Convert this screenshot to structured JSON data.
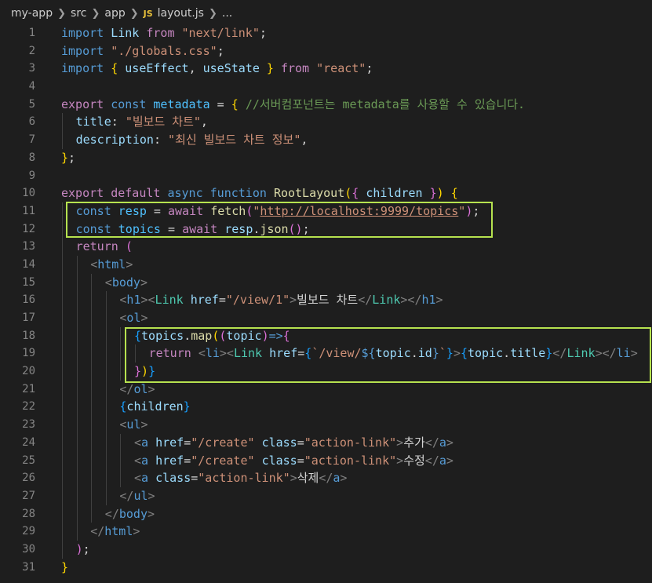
{
  "breadcrumb": {
    "items": [
      "my-app",
      "src",
      "app"
    ],
    "file_icon": "JS",
    "file_name": "layout.js",
    "ellipsis": "..."
  },
  "colors": {
    "background": "#1e1e1e",
    "highlight_box": "#b6e24f"
  },
  "icons": {
    "separator": "chevron-right-icon",
    "file": "javascript-file-icon"
  },
  "lines": [
    {
      "n": "1",
      "indent": 0,
      "tokens": [
        [
          "kw",
          "import"
        ],
        [
          "p",
          " "
        ],
        [
          "var",
          "Link"
        ],
        [
          "p",
          " "
        ],
        [
          "ctrl",
          "from"
        ],
        [
          "p",
          " "
        ],
        [
          "str",
          "\"next/link\""
        ],
        [
          "p",
          ";"
        ]
      ]
    },
    {
      "n": "2",
      "indent": 0,
      "tokens": [
        [
          "kw",
          "import"
        ],
        [
          "p",
          " "
        ],
        [
          "str",
          "\"./globals.css\""
        ],
        [
          "p",
          ";"
        ]
      ]
    },
    {
      "n": "3",
      "indent": 0,
      "tokens": [
        [
          "kw",
          "import"
        ],
        [
          "p",
          " "
        ],
        [
          "b1",
          "{"
        ],
        [
          "p",
          " "
        ],
        [
          "var",
          "useEffect"
        ],
        [
          "p",
          ", "
        ],
        [
          "var",
          "useState"
        ],
        [
          "p",
          " "
        ],
        [
          "b1",
          "}"
        ],
        [
          "p",
          " "
        ],
        [
          "ctrl",
          "from"
        ],
        [
          "p",
          " "
        ],
        [
          "str",
          "\"react\""
        ],
        [
          "p",
          ";"
        ]
      ]
    },
    {
      "n": "4",
      "indent": 0,
      "tokens": []
    },
    {
      "n": "5",
      "indent": 0,
      "tokens": [
        [
          "ctrl",
          "export"
        ],
        [
          "p",
          " "
        ],
        [
          "kw",
          "const"
        ],
        [
          "p",
          " "
        ],
        [
          "const",
          "metadata"
        ],
        [
          "p",
          " = "
        ],
        [
          "b1",
          "{"
        ],
        [
          "p",
          " "
        ],
        [
          "cmt",
          "//서버컴포넌트는 metadata를 사용할 수 있습니다."
        ]
      ]
    },
    {
      "n": "6",
      "indent": 1,
      "tokens": [
        [
          "var",
          "title"
        ],
        [
          "p",
          ": "
        ],
        [
          "str",
          "\"빌보드 차트\""
        ],
        [
          "p",
          ","
        ]
      ]
    },
    {
      "n": "7",
      "indent": 1,
      "tokens": [
        [
          "var",
          "description"
        ],
        [
          "p",
          ": "
        ],
        [
          "str",
          "\"최신 빌보드 차트 정보\""
        ],
        [
          "p",
          ","
        ]
      ]
    },
    {
      "n": "8",
      "indent": 0,
      "tokens": [
        [
          "b1",
          "}"
        ],
        [
          "p",
          ";"
        ]
      ]
    },
    {
      "n": "9",
      "indent": 0,
      "tokens": []
    },
    {
      "n": "10",
      "indent": 0,
      "tokens": [
        [
          "ctrl",
          "export"
        ],
        [
          "p",
          " "
        ],
        [
          "ctrl",
          "default"
        ],
        [
          "p",
          " "
        ],
        [
          "kw",
          "async"
        ],
        [
          "p",
          " "
        ],
        [
          "kw",
          "function"
        ],
        [
          "p",
          " "
        ],
        [
          "fn",
          "RootLayout"
        ],
        [
          "b1",
          "("
        ],
        [
          "b2",
          "{"
        ],
        [
          "p",
          " "
        ],
        [
          "var",
          "children"
        ],
        [
          "p",
          " "
        ],
        [
          "b2",
          "}"
        ],
        [
          "b1",
          ")"
        ],
        [
          "p",
          " "
        ],
        [
          "b1",
          "{"
        ]
      ]
    },
    {
      "n": "11",
      "indent": 1,
      "tokens": [
        [
          "kw",
          "const"
        ],
        [
          "p",
          " "
        ],
        [
          "const",
          "resp"
        ],
        [
          "p",
          " = "
        ],
        [
          "ctrl",
          "await"
        ],
        [
          "p",
          " "
        ],
        [
          "fn",
          "fetch"
        ],
        [
          "b2",
          "("
        ],
        [
          "str",
          "\""
        ],
        [
          "url",
          "http://localhost:9999/topics"
        ],
        [
          "str",
          "\""
        ],
        [
          "b2",
          ")"
        ],
        [
          "p",
          ";"
        ]
      ]
    },
    {
      "n": "12",
      "indent": 1,
      "tokens": [
        [
          "kw",
          "const"
        ],
        [
          "p",
          " "
        ],
        [
          "const",
          "topics"
        ],
        [
          "p",
          " = "
        ],
        [
          "ctrl",
          "await"
        ],
        [
          "p",
          " "
        ],
        [
          "var",
          "resp"
        ],
        [
          "p",
          "."
        ],
        [
          "fn",
          "json"
        ],
        [
          "b2",
          "()"
        ],
        [
          "p",
          ";"
        ]
      ]
    },
    {
      "n": "13",
      "indent": 1,
      "tokens": [
        [
          "ctrl",
          "return"
        ],
        [
          "p",
          " "
        ],
        [
          "b2",
          "("
        ]
      ]
    },
    {
      "n": "14",
      "indent": 2,
      "tokens": [
        [
          "ang",
          "<"
        ],
        [
          "tag",
          "html"
        ],
        [
          "ang",
          ">"
        ]
      ]
    },
    {
      "n": "15",
      "indent": 3,
      "tokens": [
        [
          "ang",
          "<"
        ],
        [
          "tag",
          "body"
        ],
        [
          "ang",
          ">"
        ]
      ]
    },
    {
      "n": "16",
      "indent": 4,
      "tokens": [
        [
          "ang",
          "<"
        ],
        [
          "tag",
          "h1"
        ],
        [
          "ang",
          "><"
        ],
        [
          "comp",
          "Link"
        ],
        [
          "p",
          " "
        ],
        [
          "attr",
          "href"
        ],
        [
          "p",
          "="
        ],
        [
          "str",
          "\"/view/1\""
        ],
        [
          "ang",
          ">"
        ],
        [
          "p",
          "빌보드 차트"
        ],
        [
          "ang",
          "</"
        ],
        [
          "comp",
          "Link"
        ],
        [
          "ang",
          "></"
        ],
        [
          "tag",
          "h1"
        ],
        [
          "ang",
          ">"
        ]
      ]
    },
    {
      "n": "17",
      "indent": 4,
      "tokens": [
        [
          "ang",
          "<"
        ],
        [
          "tag",
          "ol"
        ],
        [
          "ang",
          ">"
        ]
      ]
    },
    {
      "n": "18",
      "indent": 5,
      "tokens": [
        [
          "b3",
          "{"
        ],
        [
          "var",
          "topics"
        ],
        [
          "p",
          "."
        ],
        [
          "fn",
          "map"
        ],
        [
          "b1",
          "("
        ],
        [
          "b2",
          "("
        ],
        [
          "var",
          "topic"
        ],
        [
          "b2",
          ")"
        ],
        [
          "kw",
          "=>"
        ],
        [
          "b2",
          "{"
        ]
      ]
    },
    {
      "n": "19",
      "indent": 6,
      "tokens": [
        [
          "ctrl",
          "return"
        ],
        [
          "p",
          " "
        ],
        [
          "ang",
          "<"
        ],
        [
          "tag",
          "li"
        ],
        [
          "ang",
          "><"
        ],
        [
          "comp",
          "Link"
        ],
        [
          "p",
          " "
        ],
        [
          "attr",
          "href"
        ],
        [
          "p",
          "="
        ],
        [
          "b3",
          "{"
        ],
        [
          "str",
          "`/view/"
        ],
        [
          "kw",
          "${"
        ],
        [
          "var",
          "topic"
        ],
        [
          "p",
          "."
        ],
        [
          "var",
          "id"
        ],
        [
          "kw",
          "}"
        ],
        [
          "str",
          "`"
        ],
        [
          "b3",
          "}"
        ],
        [
          "ang",
          ">"
        ],
        [
          "b3",
          "{"
        ],
        [
          "var",
          "topic"
        ],
        [
          "p",
          "."
        ],
        [
          "var",
          "title"
        ],
        [
          "b3",
          "}"
        ],
        [
          "ang",
          "</"
        ],
        [
          "comp",
          "Link"
        ],
        [
          "ang",
          "></"
        ],
        [
          "tag",
          "li"
        ],
        [
          "ang",
          ">"
        ]
      ]
    },
    {
      "n": "20",
      "indent": 5,
      "tokens": [
        [
          "b2",
          "}"
        ],
        [
          "b1",
          ")"
        ],
        [
          "b3",
          "}"
        ]
      ]
    },
    {
      "n": "21",
      "indent": 4,
      "tokens": [
        [
          "ang",
          "</"
        ],
        [
          "tag",
          "ol"
        ],
        [
          "ang",
          ">"
        ]
      ]
    },
    {
      "n": "22",
      "indent": 4,
      "tokens": [
        [
          "b3",
          "{"
        ],
        [
          "var",
          "children"
        ],
        [
          "b3",
          "}"
        ]
      ]
    },
    {
      "n": "23",
      "indent": 4,
      "tokens": [
        [
          "ang",
          "<"
        ],
        [
          "tag",
          "ul"
        ],
        [
          "ang",
          ">"
        ]
      ]
    },
    {
      "n": "24",
      "indent": 5,
      "tokens": [
        [
          "ang",
          "<"
        ],
        [
          "tag",
          "a"
        ],
        [
          "p",
          " "
        ],
        [
          "attr",
          "href"
        ],
        [
          "p",
          "="
        ],
        [
          "str",
          "\"/create\""
        ],
        [
          "p",
          " "
        ],
        [
          "attr",
          "class"
        ],
        [
          "p",
          "="
        ],
        [
          "str",
          "\"action-link\""
        ],
        [
          "ang",
          ">"
        ],
        [
          "p",
          "추가"
        ],
        [
          "ang",
          "</"
        ],
        [
          "tag",
          "a"
        ],
        [
          "ang",
          ">"
        ]
      ]
    },
    {
      "n": "25",
      "indent": 5,
      "tokens": [
        [
          "ang",
          "<"
        ],
        [
          "tag",
          "a"
        ],
        [
          "p",
          " "
        ],
        [
          "attr",
          "href"
        ],
        [
          "p",
          "="
        ],
        [
          "str",
          "\"/create\""
        ],
        [
          "p",
          " "
        ],
        [
          "attr",
          "class"
        ],
        [
          "p",
          "="
        ],
        [
          "str",
          "\"action-link\""
        ],
        [
          "ang",
          ">"
        ],
        [
          "p",
          "수정"
        ],
        [
          "ang",
          "</"
        ],
        [
          "tag",
          "a"
        ],
        [
          "ang",
          ">"
        ]
      ]
    },
    {
      "n": "26",
      "indent": 5,
      "tokens": [
        [
          "ang",
          "<"
        ],
        [
          "tag",
          "a"
        ],
        [
          "p",
          " "
        ],
        [
          "attr",
          "class"
        ],
        [
          "p",
          "="
        ],
        [
          "str",
          "\"action-link\""
        ],
        [
          "ang",
          ">"
        ],
        [
          "p",
          "삭제"
        ],
        [
          "ang",
          "</"
        ],
        [
          "tag",
          "a"
        ],
        [
          "ang",
          ">"
        ]
      ]
    },
    {
      "n": "27",
      "indent": 4,
      "tokens": [
        [
          "ang",
          "</"
        ],
        [
          "tag",
          "ul"
        ],
        [
          "ang",
          ">"
        ]
      ]
    },
    {
      "n": "28",
      "indent": 3,
      "tokens": [
        [
          "ang",
          "</"
        ],
        [
          "tag",
          "body"
        ],
        [
          "ang",
          ">"
        ]
      ]
    },
    {
      "n": "29",
      "indent": 2,
      "tokens": [
        [
          "ang",
          "</"
        ],
        [
          "tag",
          "html"
        ],
        [
          "ang",
          ">"
        ]
      ]
    },
    {
      "n": "30",
      "indent": 1,
      "tokens": [
        [
          "b2",
          ")"
        ],
        [
          "p",
          ";"
        ]
      ]
    },
    {
      "n": "31",
      "indent": 0,
      "tokens": [
        [
          "b1",
          "}"
        ]
      ]
    }
  ]
}
